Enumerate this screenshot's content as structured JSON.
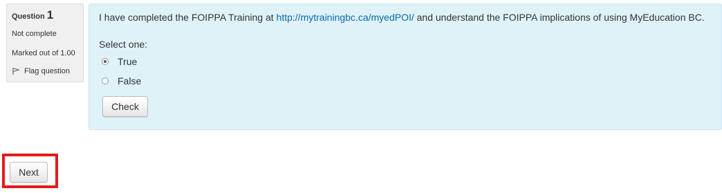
{
  "info": {
    "question_label": "Question",
    "question_number": "1",
    "state": "Not complete",
    "grade": "Marked out of 1.00",
    "flag_label": "Flag question"
  },
  "question": {
    "text_before": "I have completed the FOIPPA Training at ",
    "link_text": "http://mytrainingbc.ca/myedPOI/",
    "text_after": " and understand the FOIPPA implications of using MyEducation BC.",
    "prompt": "Select one:",
    "options": [
      {
        "label": "True",
        "selected": true
      },
      {
        "label": "False",
        "selected": false
      }
    ],
    "check_label": "Check"
  },
  "navigation": {
    "next_label": "Next",
    "highlight_color": "#e31b1b"
  },
  "colors": {
    "content_bg": "#def2f8",
    "info_bg": "#f0f0f0",
    "link": "#0a6ba8"
  },
  "icons": {
    "flag": "flag-icon"
  }
}
